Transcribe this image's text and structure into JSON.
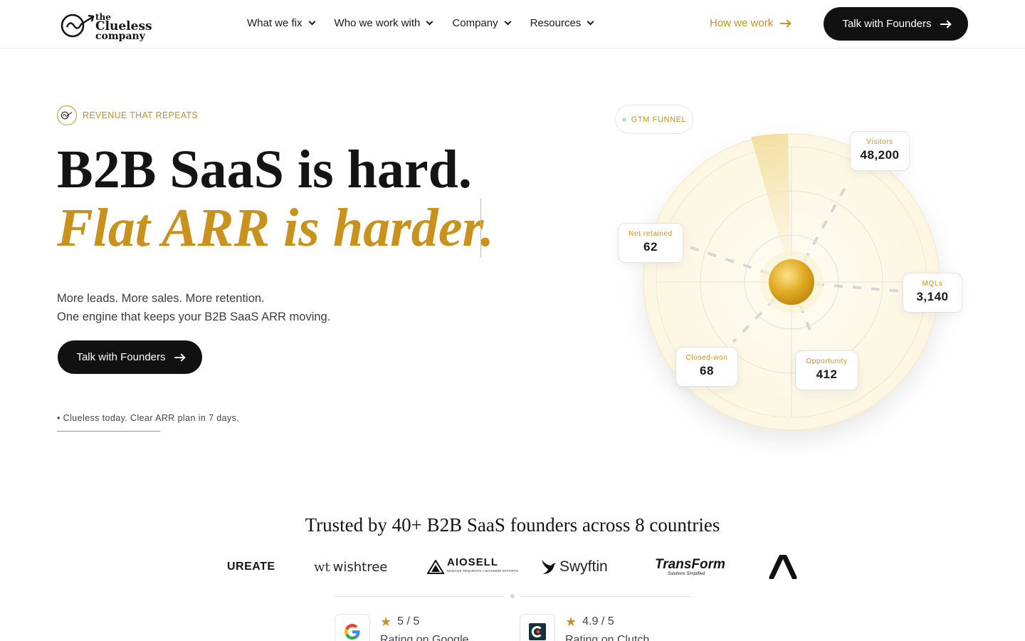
{
  "nav": {
    "logo": {
      "line1": "the",
      "line2": "Clueless",
      "line3": "company"
    },
    "menu": [
      {
        "label": "What we fix"
      },
      {
        "label": "Who we work with"
      },
      {
        "label": "Company"
      },
      {
        "label": "Resources"
      }
    ],
    "how_we_work": "How we work",
    "cta": "Talk with Founders"
  },
  "hero": {
    "eyebrow": "REVENUE THAT REPEATS",
    "headline_line1": "B2B SaaS is hard.",
    "headline_line2": "Flat ARR is harder.",
    "sub_line1": "More leads. More sales. More retention.",
    "sub_line2": "One engine that keeps your B2B SaaS ARR moving.",
    "cta": "Talk with Founders",
    "note": "• Clueless today. Clear ARR plan in 7 days."
  },
  "funnel": {
    "badge": "GTM FUNNEL",
    "cards": {
      "visitors": {
        "label": "Visitors",
        "value": "48,200"
      },
      "mqls": {
        "label": "MQLs",
        "value": "3,140"
      },
      "opportunity": {
        "label": "Opportunity",
        "value": "412"
      },
      "closed_won": {
        "label": "Closed-won",
        "value": "68"
      },
      "net_retained": {
        "label": "Net retained",
        "value": "62"
      }
    }
  },
  "trust": {
    "heading": "Trusted by 40+ B2B SaaS founders across 8 countries",
    "logos": [
      "UREATE",
      "wishtree",
      "AIOSELL",
      "Swyftin",
      "TransForm",
      "Solutions Simplified",
      "MANAGE REQUESTS • MAXIMIZE EFFORTS"
    ]
  },
  "ratings": [
    {
      "score": "5 / 5",
      "label": "Rating on Google"
    },
    {
      "score": "4.9 / 5",
      "label": "Rating on Clutch"
    }
  ],
  "colors": {
    "accent": "#c8921c",
    "dark": "#111111"
  }
}
